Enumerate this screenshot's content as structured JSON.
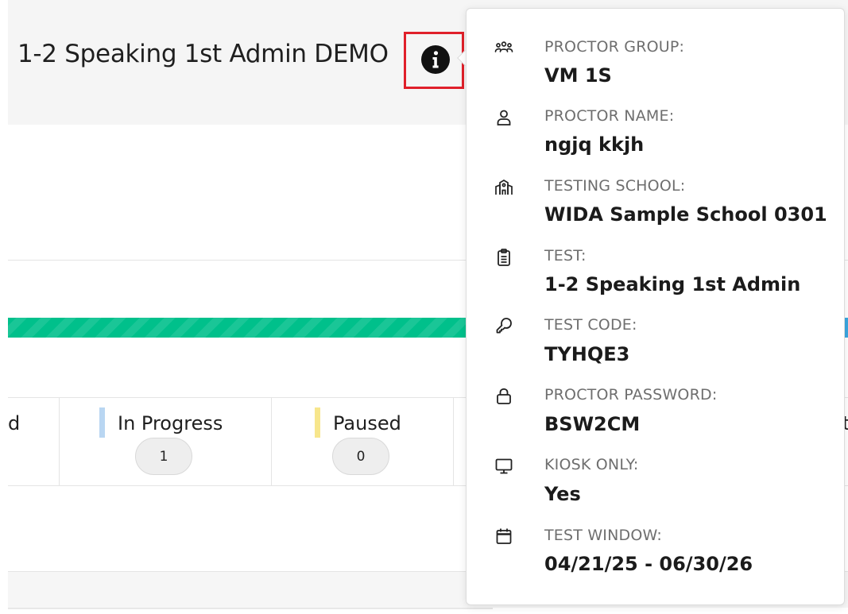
{
  "header": {
    "title": "1-2 Speaking 1st Admin DEMO"
  },
  "progress": {
    "fill_color": "#00c08b",
    "secondary_color": "#3aa7e0"
  },
  "stats": [
    {
      "label": "d",
      "count": ""
    },
    {
      "label": "In Progress",
      "count": "1",
      "color": "#b9d6f2"
    },
    {
      "label": "Paused",
      "count": "0",
      "color": "#f7e68c"
    },
    {
      "label": "t",
      "count": ""
    }
  ],
  "details": [
    {
      "icon": "users-group-icon",
      "label": "PROCTOR GROUP:",
      "value": "VM 1S"
    },
    {
      "icon": "user-icon",
      "label": "PROCTOR NAME:",
      "value": "ngjq kkjh"
    },
    {
      "icon": "school-icon",
      "label": "TESTING SCHOOL:",
      "value": "WIDA Sample School 0301"
    },
    {
      "icon": "clipboard-icon",
      "label": "TEST:",
      "value": "1-2 Speaking 1st Admin"
    },
    {
      "icon": "key-icon",
      "label": "TEST CODE:",
      "value": "TYHQE3"
    },
    {
      "icon": "lock-icon",
      "label": "PROCTOR PASSWORD:",
      "value": "BSW2CM"
    },
    {
      "icon": "monitor-icon",
      "label": "KIOSK ONLY:",
      "value": "Yes"
    },
    {
      "icon": "calendar-icon",
      "label": "TEST WINDOW:",
      "value": "04/21/25 - 06/30/26"
    }
  ]
}
